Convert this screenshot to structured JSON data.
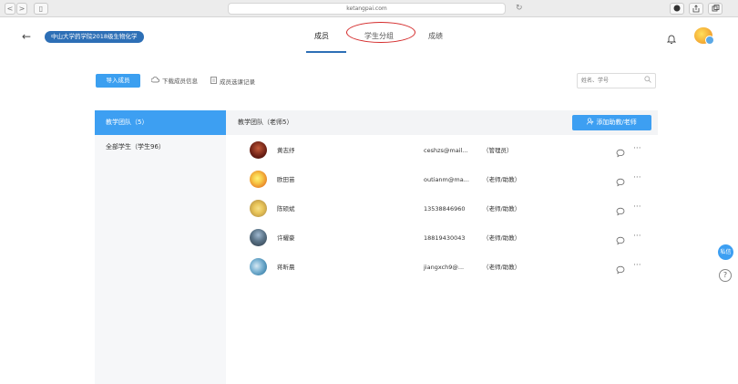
{
  "browser": {
    "url": "ketangpai.com",
    "back_glyph": "<",
    "fwd_glyph": ">",
    "sidebar_glyph": "▯",
    "reload_glyph": "↻"
  },
  "header": {
    "back_glyph": "←",
    "class_name": "中山大学药学院2018级生物化学",
    "tabs": [
      {
        "label": "成员",
        "active": true
      },
      {
        "label": "学生分组",
        "active": false,
        "highlighted": true
      },
      {
        "label": "成绩",
        "active": false
      }
    ]
  },
  "toolbar": {
    "import_label": "导入成员",
    "download_label": "下载成员信息",
    "records_label": "成员选课记录",
    "search_placeholder": "姓名、学号"
  },
  "left_panel": {
    "items": [
      {
        "label": "教学团队（5）",
        "active": true
      },
      {
        "label": "全部学生（学生96）",
        "active": false
      }
    ]
  },
  "right_panel": {
    "title": "教学团队（老师5）",
    "add_button": "添加助教/老师",
    "members": [
      {
        "name": "黄志纾",
        "contact": "ceshzs@mail...",
        "role": "（管理员）"
      },
      {
        "name": "欧田苗",
        "contact": "outianm@ma...",
        "role": "（老师/助教）"
      },
      {
        "name": "陈硕斌",
        "contact": "13538846960",
        "role": "（老师/助教）"
      },
      {
        "name": "许耀豪",
        "contact": "18819430043",
        "role": "（老师/助教）"
      },
      {
        "name": "蒋昕晨",
        "contact": "jiangxch9@...",
        "role": "（老师/助教）"
      }
    ]
  },
  "floating": {
    "message_label": "私信",
    "help_glyph": "?"
  },
  "colors": {
    "accent": "#3d9ff2",
    "class_pill": "#2d6fb6",
    "annotation_circle": "#d42a2a"
  }
}
